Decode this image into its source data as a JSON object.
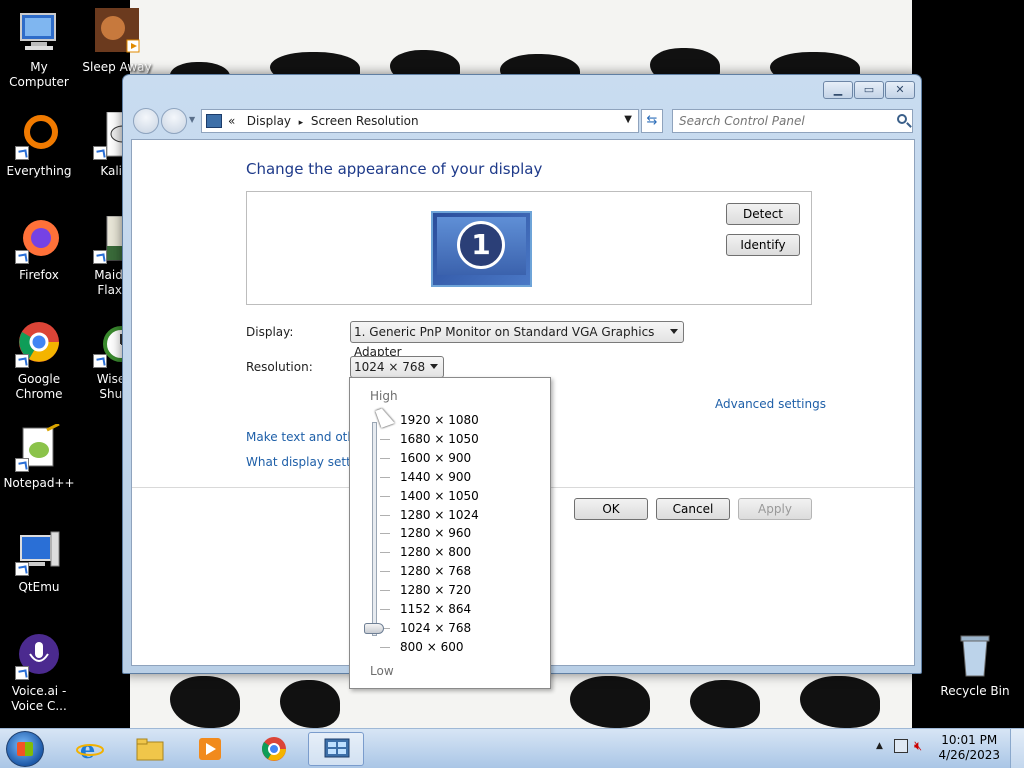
{
  "desktop_icons": [
    {
      "label": "My Computer"
    },
    {
      "label": "Sleep Away"
    },
    {
      "label": "Everything"
    },
    {
      "label": "Kalim"
    },
    {
      "label": "Firefox"
    },
    {
      "label": "Maid wi Flaxen"
    },
    {
      "label": "Google Chrome"
    },
    {
      "label": "Wise A Shutd"
    },
    {
      "label": "Notepad++"
    },
    {
      "label": "QtEmu"
    },
    {
      "label": "Voice.ai - Voice C..."
    },
    {
      "label": "Recycle Bin"
    }
  ],
  "address": {
    "prefix": "«",
    "crumb1": "Display",
    "sep": "▸",
    "crumb2": "Screen Resolution"
  },
  "search": {
    "placeholder": "Search Control Panel"
  },
  "page": {
    "title": "Change the appearance of your display",
    "detect": "Detect",
    "identify": "Identify",
    "monitor_number": "1",
    "display_label": "Display:",
    "display_value": "1. Generic PnP Monitor on Standard VGA Graphics Adapter",
    "resolution_label": "Resolution:",
    "resolution_value": "1024 × 768",
    "advanced": "Advanced settings",
    "link1": "Make text and other",
    "link2": "What display setting",
    "ok": "OK",
    "cancel": "Cancel",
    "apply": "Apply"
  },
  "resolution_list": {
    "high": "High",
    "low": "Low",
    "options": [
      "1920 × 1080",
      "1680 × 1050",
      "1600 × 900",
      "1440 × 900",
      "1400 × 1050",
      "1280 × 1024",
      "1280 × 960",
      "1280 × 800",
      "1280 × 768",
      "1280 × 720",
      "1152 × 864",
      "1024 × 768",
      "800 × 600"
    ],
    "selected": "1024 × 768"
  },
  "tray": {
    "time": "10:01 PM",
    "date": "4/26/2023"
  },
  "colors": {
    "title_blue": "#1e3a8a",
    "link_blue": "#1e5fa8"
  }
}
